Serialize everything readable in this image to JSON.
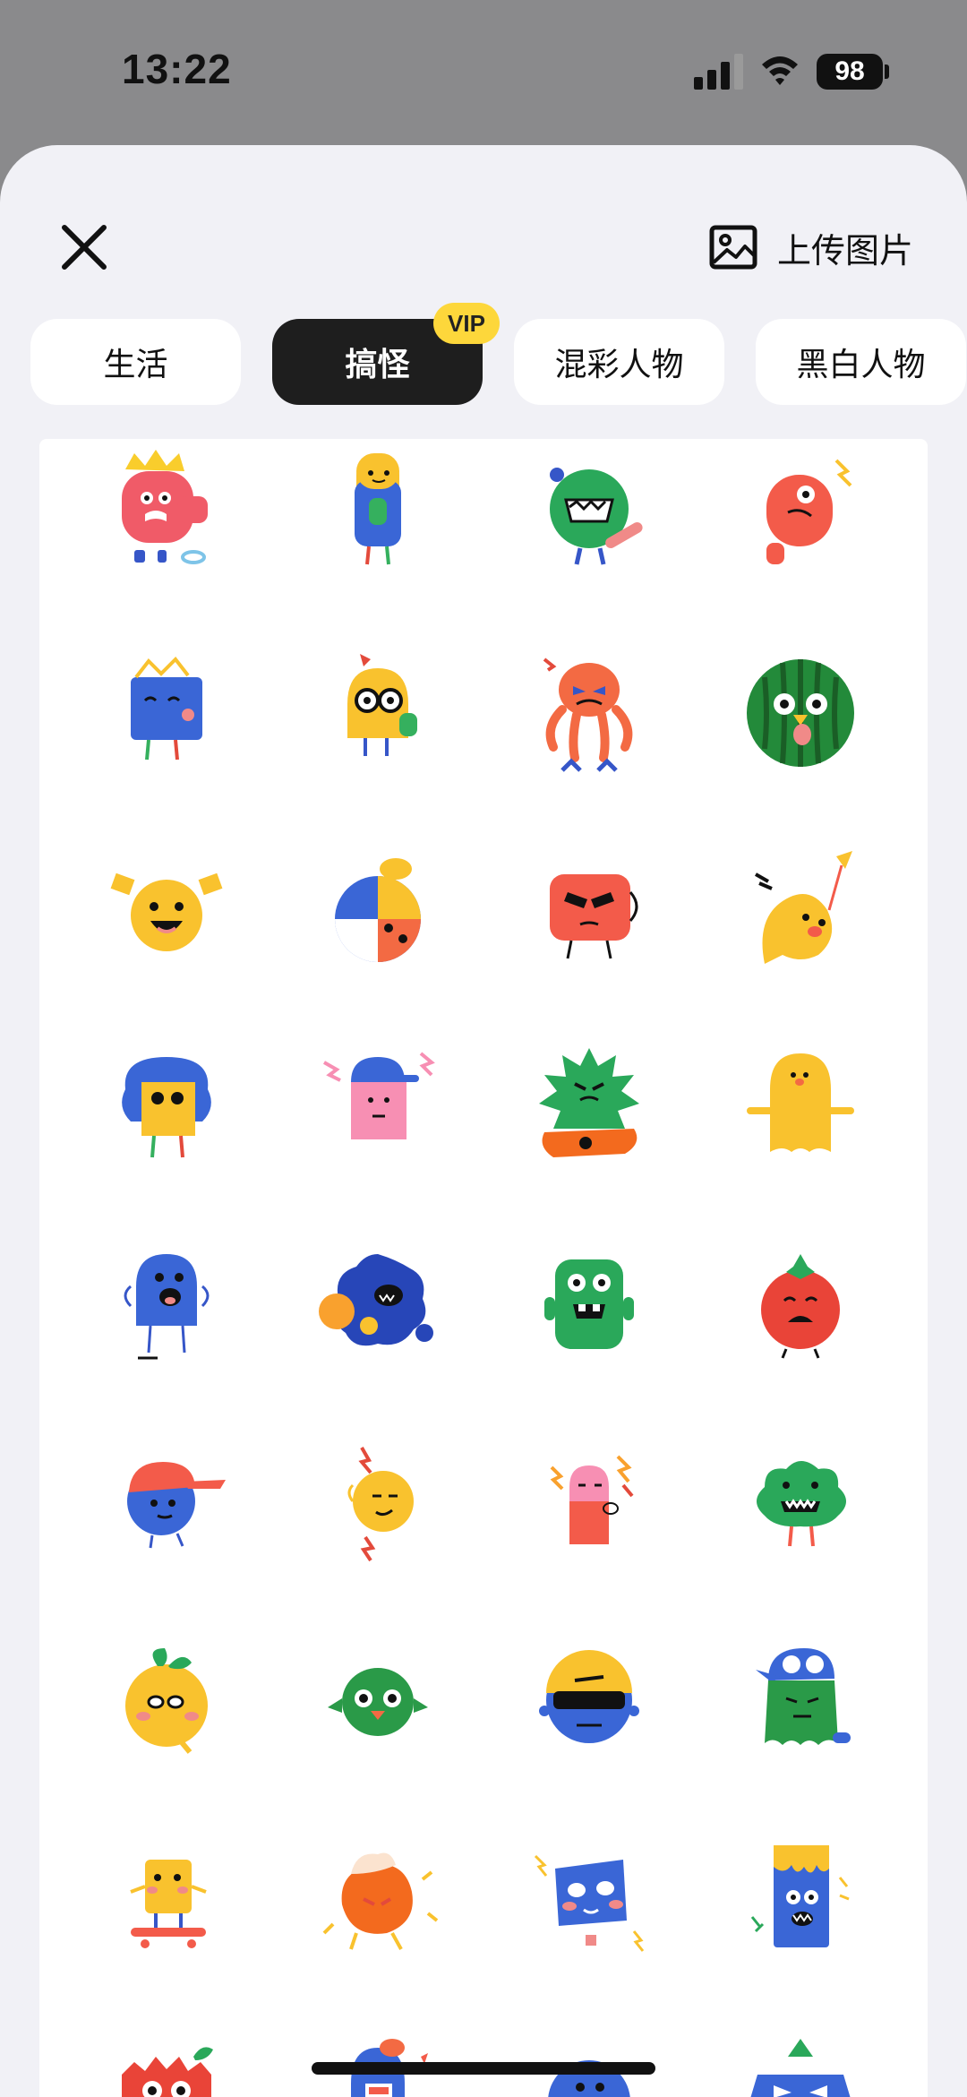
{
  "status_bar": {
    "time": "13:22",
    "battery_level": "98",
    "icons": [
      "signal-icon",
      "wifi-icon",
      "battery-icon"
    ]
  },
  "header": {
    "close_icon": "close-icon",
    "upload_label": "上传图片",
    "upload_icon": "image-icon"
  },
  "tabs": [
    {
      "label": "生活",
      "active": false
    },
    {
      "label": "搞怪",
      "active": true,
      "badge": "VIP"
    },
    {
      "label": "混彩人物",
      "active": false
    },
    {
      "label": "黑白人物",
      "active": false
    }
  ],
  "stickers": [
    "crown-monster-sticker",
    "tall-yellow-head-sticker",
    "green-fuzzy-monster-sticker",
    "red-one-eye-monster-sticker",
    "blue-box-monster-sticker",
    "yellow-glasses-ghost-sticker",
    "orange-octopus-sticker",
    "watermelon-sticker",
    "yellow-angry-face-sticker",
    "split-color-ball-sticker",
    "red-sunglasses-monster-sticker",
    "yellow-ghost-sticker",
    "blue-hair-box-sticker",
    "pink-cap-monster-sticker",
    "green-spiky-monster-sticker",
    "yellow-blob-sticker",
    "blue-screaming-monster-sticker",
    "blue-splash-monster-sticker",
    "green-robot-monster-sticker",
    "tomato-sticker",
    "blue-cap-ball-sticker",
    "yellow-lightning-face-sticker",
    "pink-ghost-sticker",
    "green-cloud-monster-sticker",
    "lemon-face-sticker",
    "green-bird-sticker",
    "blue-sunglasses-ball-sticker",
    "green-cap-monster-sticker",
    "skateboard-sticker",
    "orange-ice-cream-sticker",
    "blue-square-face-sticker",
    "blue-phone-monster-sticker",
    "red-spiky-sticker",
    "blue-hat-sticker",
    "blue-round-sticker",
    "purple-blue-sticker"
  ],
  "colors": {
    "sheet_bg": "#f1f1f6",
    "tab_active_bg": "#1e1e1e",
    "vip_badge": "#fdd73b"
  }
}
